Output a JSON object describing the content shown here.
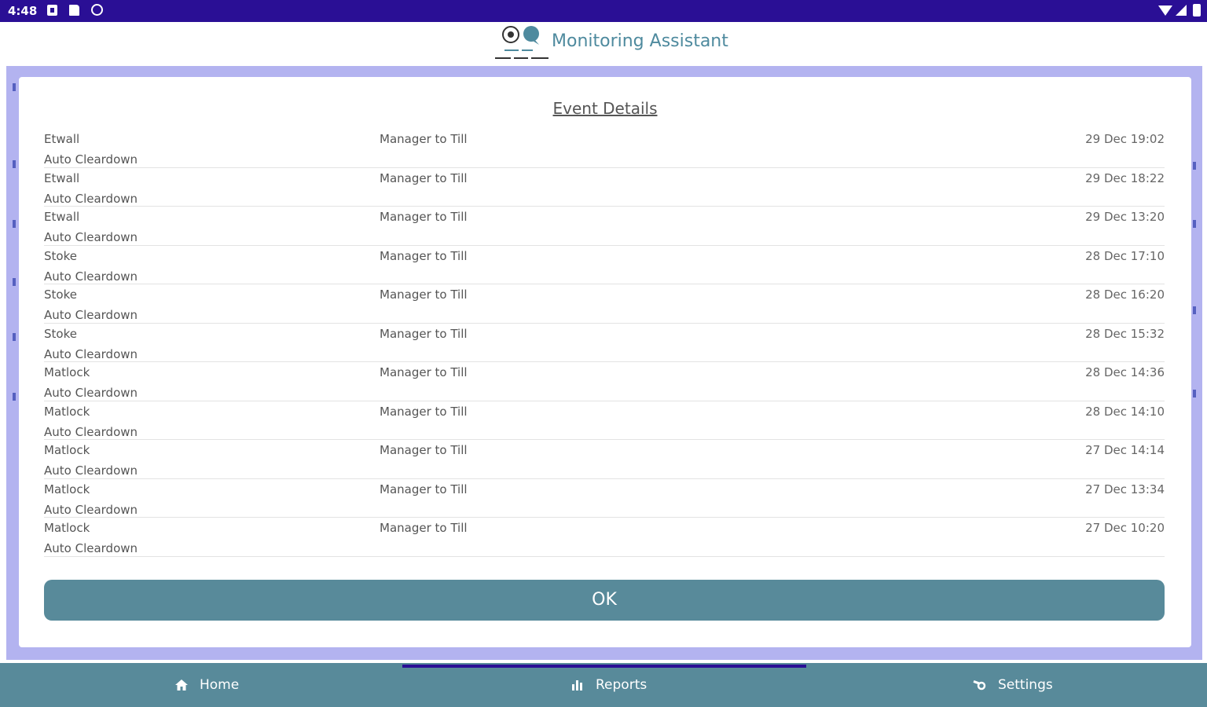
{
  "status_bar": {
    "time": "4:48"
  },
  "header": {
    "title": "Monitoring Assistant"
  },
  "dialog": {
    "title": "Event Details",
    "events": [
      {
        "site": "Etwall",
        "type": "Manager to Till",
        "date": "29 Dec 19:02",
        "description": "Auto Cleardown"
      },
      {
        "site": "Etwall",
        "type": "Manager to Till",
        "date": "29 Dec 18:22",
        "description": "Auto Cleardown"
      },
      {
        "site": "Etwall",
        "type": "Manager to Till",
        "date": "29 Dec 13:20",
        "description": "Auto Cleardown"
      },
      {
        "site": "Stoke",
        "type": "Manager to Till",
        "date": "28 Dec 17:10",
        "description": "Auto Cleardown"
      },
      {
        "site": "Stoke",
        "type": "Manager to Till",
        "date": "28 Dec 16:20",
        "description": "Auto Cleardown"
      },
      {
        "site": "Stoke",
        "type": "Manager to Till",
        "date": "28 Dec 15:32",
        "description": "Auto Cleardown"
      },
      {
        "site": "Matlock",
        "type": "Manager to Till",
        "date": "28 Dec 14:36",
        "description": "Auto Cleardown"
      },
      {
        "site": "Matlock",
        "type": "Manager to Till",
        "date": "28 Dec 14:10",
        "description": "Auto Cleardown"
      },
      {
        "site": "Matlock",
        "type": "Manager to Till",
        "date": "27 Dec 14:14",
        "description": "Auto Cleardown"
      },
      {
        "site": "Matlock",
        "type": "Manager to Till",
        "date": "27 Dec 13:34",
        "description": "Auto Cleardown"
      },
      {
        "site": "Matlock",
        "type": "Manager to Till",
        "date": "27 Dec 10:20",
        "description": "Auto Cleardown"
      }
    ],
    "ok_label": "OK"
  },
  "nav": {
    "items": [
      {
        "label": "Home",
        "icon": "home-icon"
      },
      {
        "label": "Reports",
        "icon": "bar-chart-icon"
      },
      {
        "label": "Settings",
        "icon": "settings-icon"
      }
    ]
  },
  "colors": {
    "status_bar": "#2a0f95",
    "accent": "#588a9a",
    "title_text": "#4e8a9e",
    "frame": "#b3b3f0"
  }
}
